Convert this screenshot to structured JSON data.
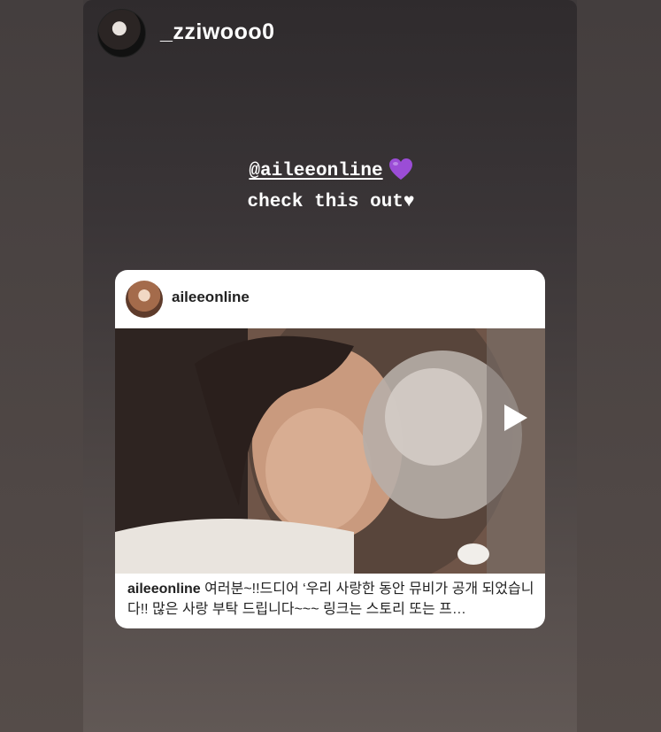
{
  "story": {
    "username": "_zziwooo0",
    "avatar_icon": "profile-avatar",
    "mention": "@aileeonline",
    "mention_emoji": "purple-heart-icon",
    "caption_line2": "check this out♥"
  },
  "shared_post": {
    "username": "aileeonline",
    "avatar_icon": "profile-avatar",
    "media_icon": "play-icon",
    "caption_user": "aileeonline",
    "caption_text": "여러분~!!드디어 ‘우리 사랑한 동안 뮤비가 공개 되었습니다!! 많은 사랑 부탁 드립니다~~~ 링크는 스토리 또는 프…"
  },
  "colors": {
    "text": "#ffffff",
    "card_background": "#ffffff",
    "emoji_purple": "#9b4dd6"
  }
}
